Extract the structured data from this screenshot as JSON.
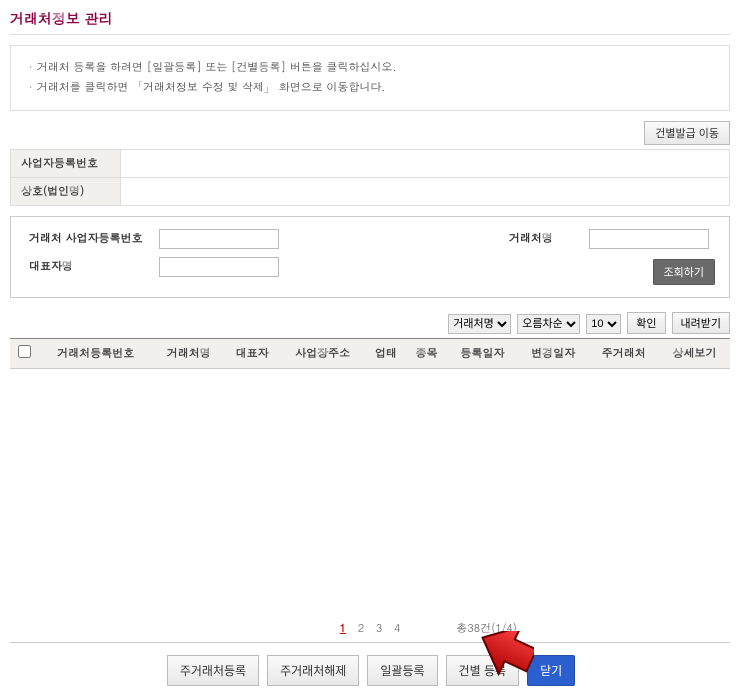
{
  "title": "거래처정보 관리",
  "info_lines": [
    "거래처 등록을 하려면 [일괄등록] 또는 [건별등록] 버튼을 클릭하십시오.",
    "거래처를 클릭하면 「거래처정보 수정 및 삭제」 화면으로 이동합니다."
  ],
  "top_button": "건별발급 이동",
  "info_rows": [
    {
      "label": "사업자등록번호",
      "value": ""
    },
    {
      "label": "상호(법인명)",
      "value": ""
    }
  ],
  "search": {
    "biz_no_label": "거래처 사업자등록번호",
    "biz_no_value": "",
    "name_label": "거래처명",
    "name_value": "",
    "rep_label": "대표자명",
    "rep_value": "",
    "button": "조회하기"
  },
  "filters": {
    "sort_field": {
      "options": [
        "거래처명"
      ],
      "selected": "거래처명"
    },
    "sort_dir": {
      "options": [
        "오름차순"
      ],
      "selected": "오름차순"
    },
    "page_size": {
      "options": [
        "10"
      ],
      "selected": "10"
    },
    "confirm": "확인",
    "download": "내려받기"
  },
  "columns": [
    "거래처등록번호",
    "거래처명",
    "대표자",
    "사업장주소",
    "업태",
    "종목",
    "등록일자",
    "변경일자",
    "주거래처",
    "상세보기"
  ],
  "pager": {
    "pages": [
      "1",
      "2",
      "3",
      "4"
    ],
    "active": "1",
    "total_text": "총38건(1/4)"
  },
  "bottom_buttons": {
    "main_reg": "주거래처등록",
    "main_unreg": "주거래처해제",
    "batch_reg": "일괄등록",
    "single_reg": "건별 등록",
    "close": "닫기"
  }
}
